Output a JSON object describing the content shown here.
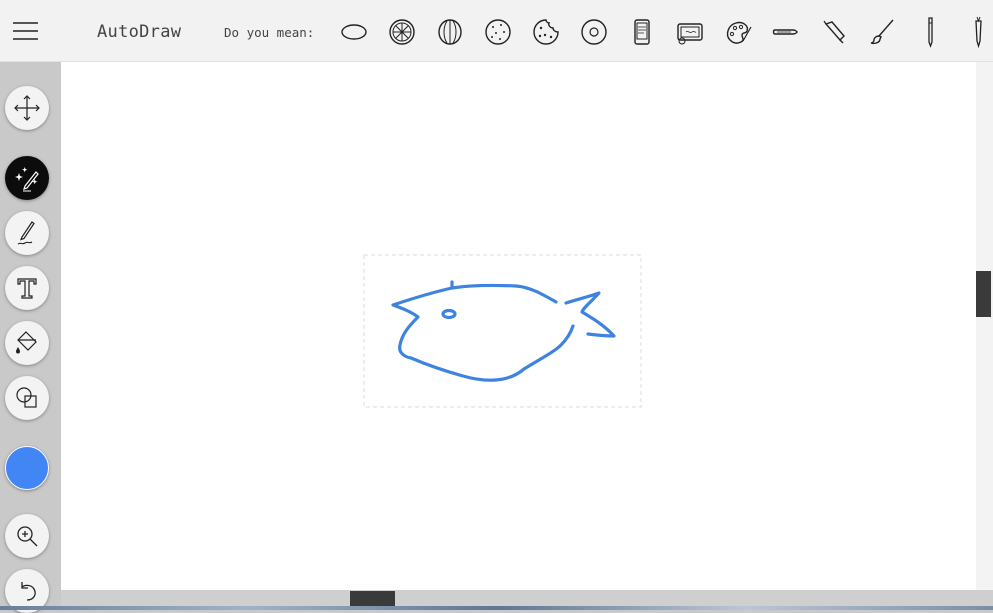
{
  "app": {
    "title": "AutoDraw"
  },
  "toolbar": {
    "menu_icon": "hamburger-menu-icon",
    "suggestion_label": "Do you mean:",
    "suggestions": [
      {
        "name": "oval"
      },
      {
        "name": "citrus-slice"
      },
      {
        "name": "lemon"
      },
      {
        "name": "cookie-round"
      },
      {
        "name": "cookie-bitten"
      },
      {
        "name": "donut"
      },
      {
        "name": "phone"
      },
      {
        "name": "tablet-device"
      },
      {
        "name": "paint-palette"
      },
      {
        "name": "paint-tube"
      },
      {
        "name": "glue-tube"
      },
      {
        "name": "paintbrush"
      },
      {
        "name": "pencil"
      },
      {
        "name": "carrot"
      }
    ]
  },
  "tools": [
    {
      "name": "move-tool",
      "icon": "move-arrows-icon"
    },
    {
      "name": "autodraw-tool",
      "icon": "autodraw-sparkle-pen-icon",
      "active": true
    },
    {
      "name": "draw-tool",
      "icon": "pencil-squiggle-icon"
    },
    {
      "name": "type-tool",
      "icon": "text-T-icon"
    },
    {
      "name": "fill-tool",
      "icon": "paint-bucket-icon"
    },
    {
      "name": "shape-tool",
      "icon": "shapes-icon"
    },
    {
      "name": "zoom-tool",
      "icon": "zoom-in-icon"
    },
    {
      "name": "undo-tool",
      "icon": "undo-icon"
    }
  ],
  "colors": {
    "stroke": "#4285f4",
    "active_tool_bg": "#0c0c0c",
    "swatch": "#4285f4"
  }
}
